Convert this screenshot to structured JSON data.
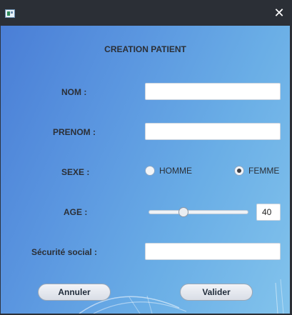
{
  "window": {
    "icon": "app-window-icon",
    "close_glyph": "✕"
  },
  "form": {
    "heading": "CREATION PATIENT",
    "nom_label": "NOM :",
    "nom_value": "",
    "prenom_label": "PRENOM :",
    "prenom_value": "",
    "sexe_label": "SEXE :",
    "sexe_options": [
      {
        "label": "HOMME",
        "selected": false
      },
      {
        "label": "FEMME",
        "selected": true
      }
    ],
    "age_label": "AGE :",
    "age_value": "40",
    "age_slider_fraction": 0.33,
    "secu_label": "Sécurité social :",
    "secu_value": ""
  },
  "actions": {
    "cancel_label": "Annuler",
    "submit_label": "Valider"
  },
  "colors": {
    "titlebar": "#2b2f36",
    "background_start": "#4a7ed6",
    "background_end": "#82c3ec",
    "label_text": "#2b2f36"
  }
}
